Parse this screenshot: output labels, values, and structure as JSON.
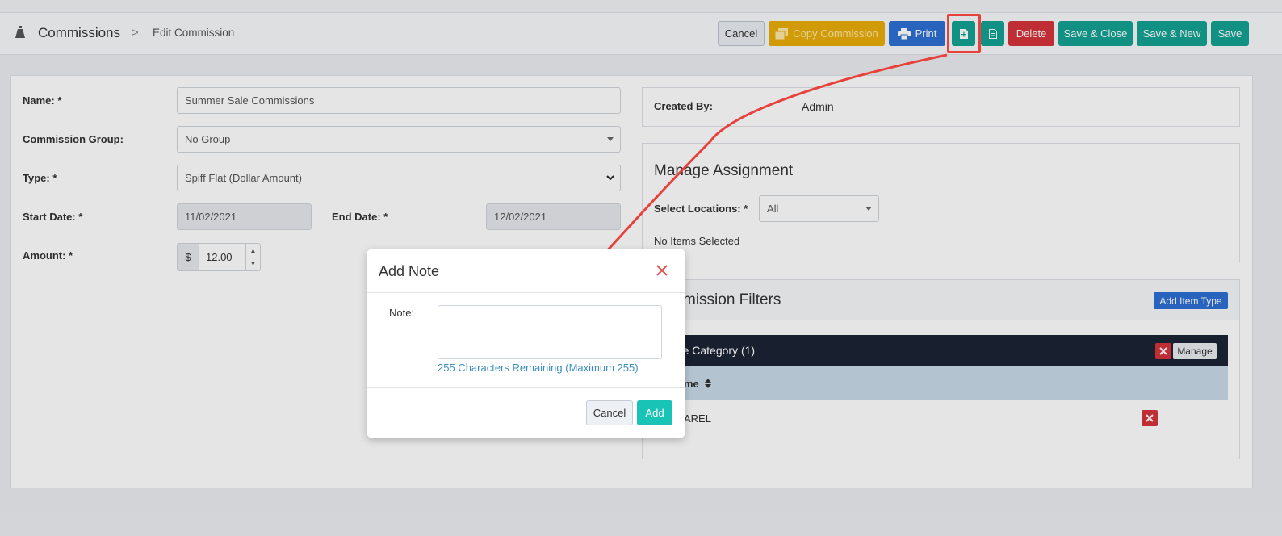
{
  "header": {
    "title": "Commissions",
    "breadcrumb_sep": ">",
    "breadcrumb": "Edit Commission",
    "buttons": {
      "cancel": "Cancel",
      "copy": "Copy Commission",
      "print": "Print",
      "delete": "Delete",
      "save_close": "Save & Close",
      "save_new": "Save & New",
      "save": "Save"
    }
  },
  "form": {
    "name_label": "Name: *",
    "name_value": "Summer Sale Commissions",
    "group_label": "Commission Group:",
    "group_value": "No Group",
    "type_label": "Type: *",
    "type_value": "Spiff Flat (Dollar Amount)",
    "start_label": "Start Date: *",
    "start_value": "11/02/2021",
    "end_label": "End Date: *",
    "end_value": "12/02/2021",
    "amount_label": "Amount: *",
    "amount_currency": "$",
    "amount_value": "12.00"
  },
  "right": {
    "created_label": "Created By:",
    "created_value": "Admin",
    "assignment_title": "Manage Assignment",
    "locations_label": "Select Locations: *",
    "locations_value": "All",
    "no_items": "No Items Selected",
    "filters_title": "Commission Filters",
    "filters_title_visible": "mission Filters",
    "add_item_type": "Add Item Type",
    "category_header": "age Category (1)",
    "manage": "Manage",
    "col_name": "me",
    "row_value": "AREL"
  },
  "modal": {
    "title": "Add Note",
    "note_label": "Note:",
    "note_value": "",
    "remaining": "255 Characters Remaining (Maximum 255)",
    "cancel": "Cancel",
    "add": "Add"
  },
  "colors": {
    "teal": "#14a294",
    "add_teal": "#19c3b6",
    "red": "#d6343c",
    "blue": "#2d6fd4",
    "yellow": "#e9ac08",
    "annotation": "#e8413b"
  },
  "icons": [
    "money-bag-icon",
    "printer-icon",
    "note-icon",
    "document-icon",
    "copy-icon",
    "close-icon",
    "sort-icon"
  ]
}
